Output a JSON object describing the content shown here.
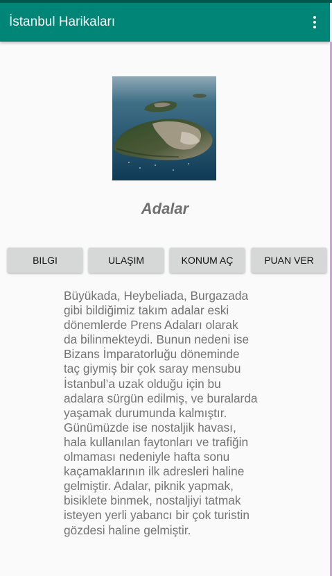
{
  "app_bar": {
    "title": "İstanbul Harikaları",
    "menu_icon": "more-vert-icon"
  },
  "place": {
    "image": "aerial-islands-photo",
    "title": "Adalar"
  },
  "buttons": {
    "info": "BILGI",
    "transport": "ULAŞIM",
    "open_location": "KONUM AÇ",
    "rate": "PUAN VER"
  },
  "description": "Büyükada, Heybeliada, Burgazada\ngibi bildiğimiz takım adalar eski\ndönemlerde Prens Adaları olarak\nda bilinmekteydi. Bunun nedeni ise\nBizans İmparatorluğu döneminde\ntaç giymiş bir çok saray mensubu\nİstanbul’a uzak olduğu için bu\nadalara sürgün edilmiş, ve buralarda\nyaşamak durumunda kalmıştır.\nGünümüzde ise nostaljik havası,\nhala kullanılan faytonları ve trafiğin\nolmaması nedeniyle hafta sonu\nkaçamaklarının ilk adresleri haline\ngelmiştir. Adalar, piknik yapmak,\nbisiklete binmek, nostaljiyi tatmak\nisteyen yerli yabancı bir çok turistin\ngözdesi haline gelmiştir.",
  "colors": {
    "primary": "#008577",
    "primary_dark": "#00574b",
    "background": "#fafafa",
    "button": "#d6d7d7",
    "text_secondary": "#737373"
  }
}
